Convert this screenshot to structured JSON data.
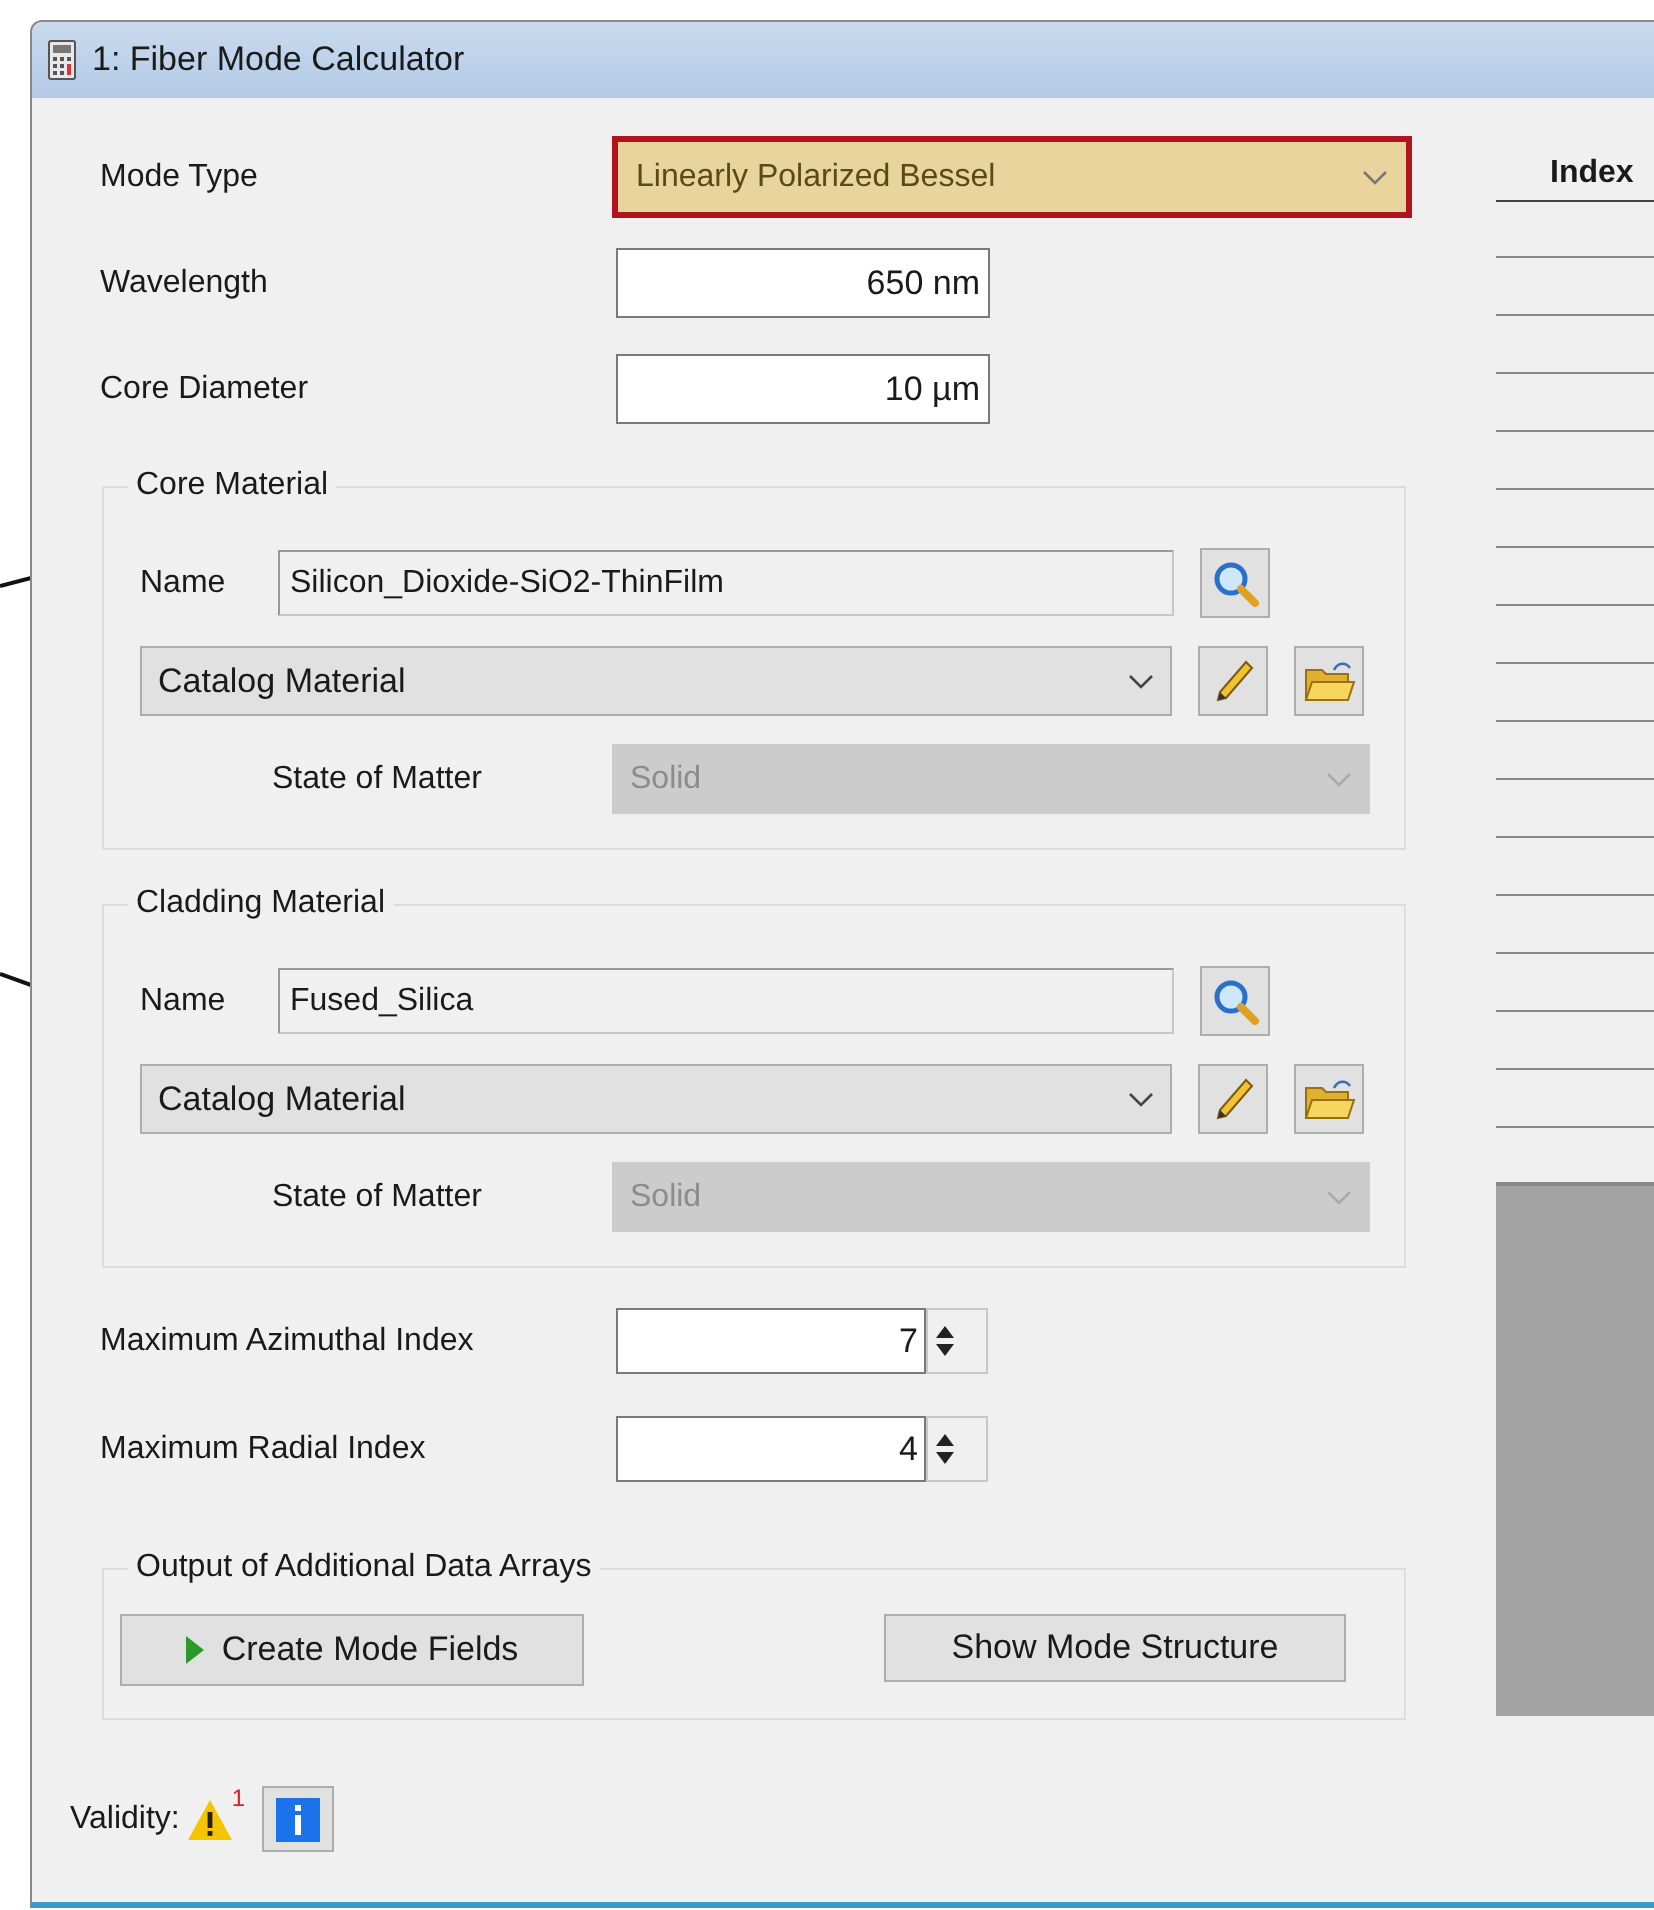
{
  "window": {
    "title": "1: Fiber Mode Calculator"
  },
  "mode_type": {
    "label": "Mode Type",
    "value": "Linearly Polarized Bessel",
    "highlighted": true
  },
  "wavelength": {
    "label": "Wavelength",
    "value": "650 nm"
  },
  "core_diameter": {
    "label": "Core Diameter",
    "value": "10 µm"
  },
  "materials": [
    {
      "title": "Core Material",
      "name_label": "Name",
      "name": "Silicon_Dioxide-SiO2-ThinFilm",
      "source": "Catalog Material",
      "state_label": "State of Matter",
      "state": "Solid",
      "state_disabled": true
    },
    {
      "title": "Cladding Material",
      "name_label": "Name",
      "name": "Fused_Silica",
      "source": "Catalog Material",
      "state_label": "State of Matter",
      "state": "Solid",
      "state_disabled": true
    }
  ],
  "max_azimuthal_index": {
    "label": "Maximum Azimuthal Index",
    "value": "7"
  },
  "max_radial_index": {
    "label": "Maximum Radial Index",
    "value": "4"
  },
  "output": {
    "title": "Output of Additional Data Arrays",
    "buttons": [
      {
        "label": "Create Mode Fields",
        "kind": "run"
      },
      {
        "label": "Show Mode Structure",
        "kind": "plain"
      }
    ]
  },
  "validity": {
    "label": "Validity:",
    "warning_count": "1"
  },
  "table": {
    "columns": [
      "Index"
    ]
  }
}
